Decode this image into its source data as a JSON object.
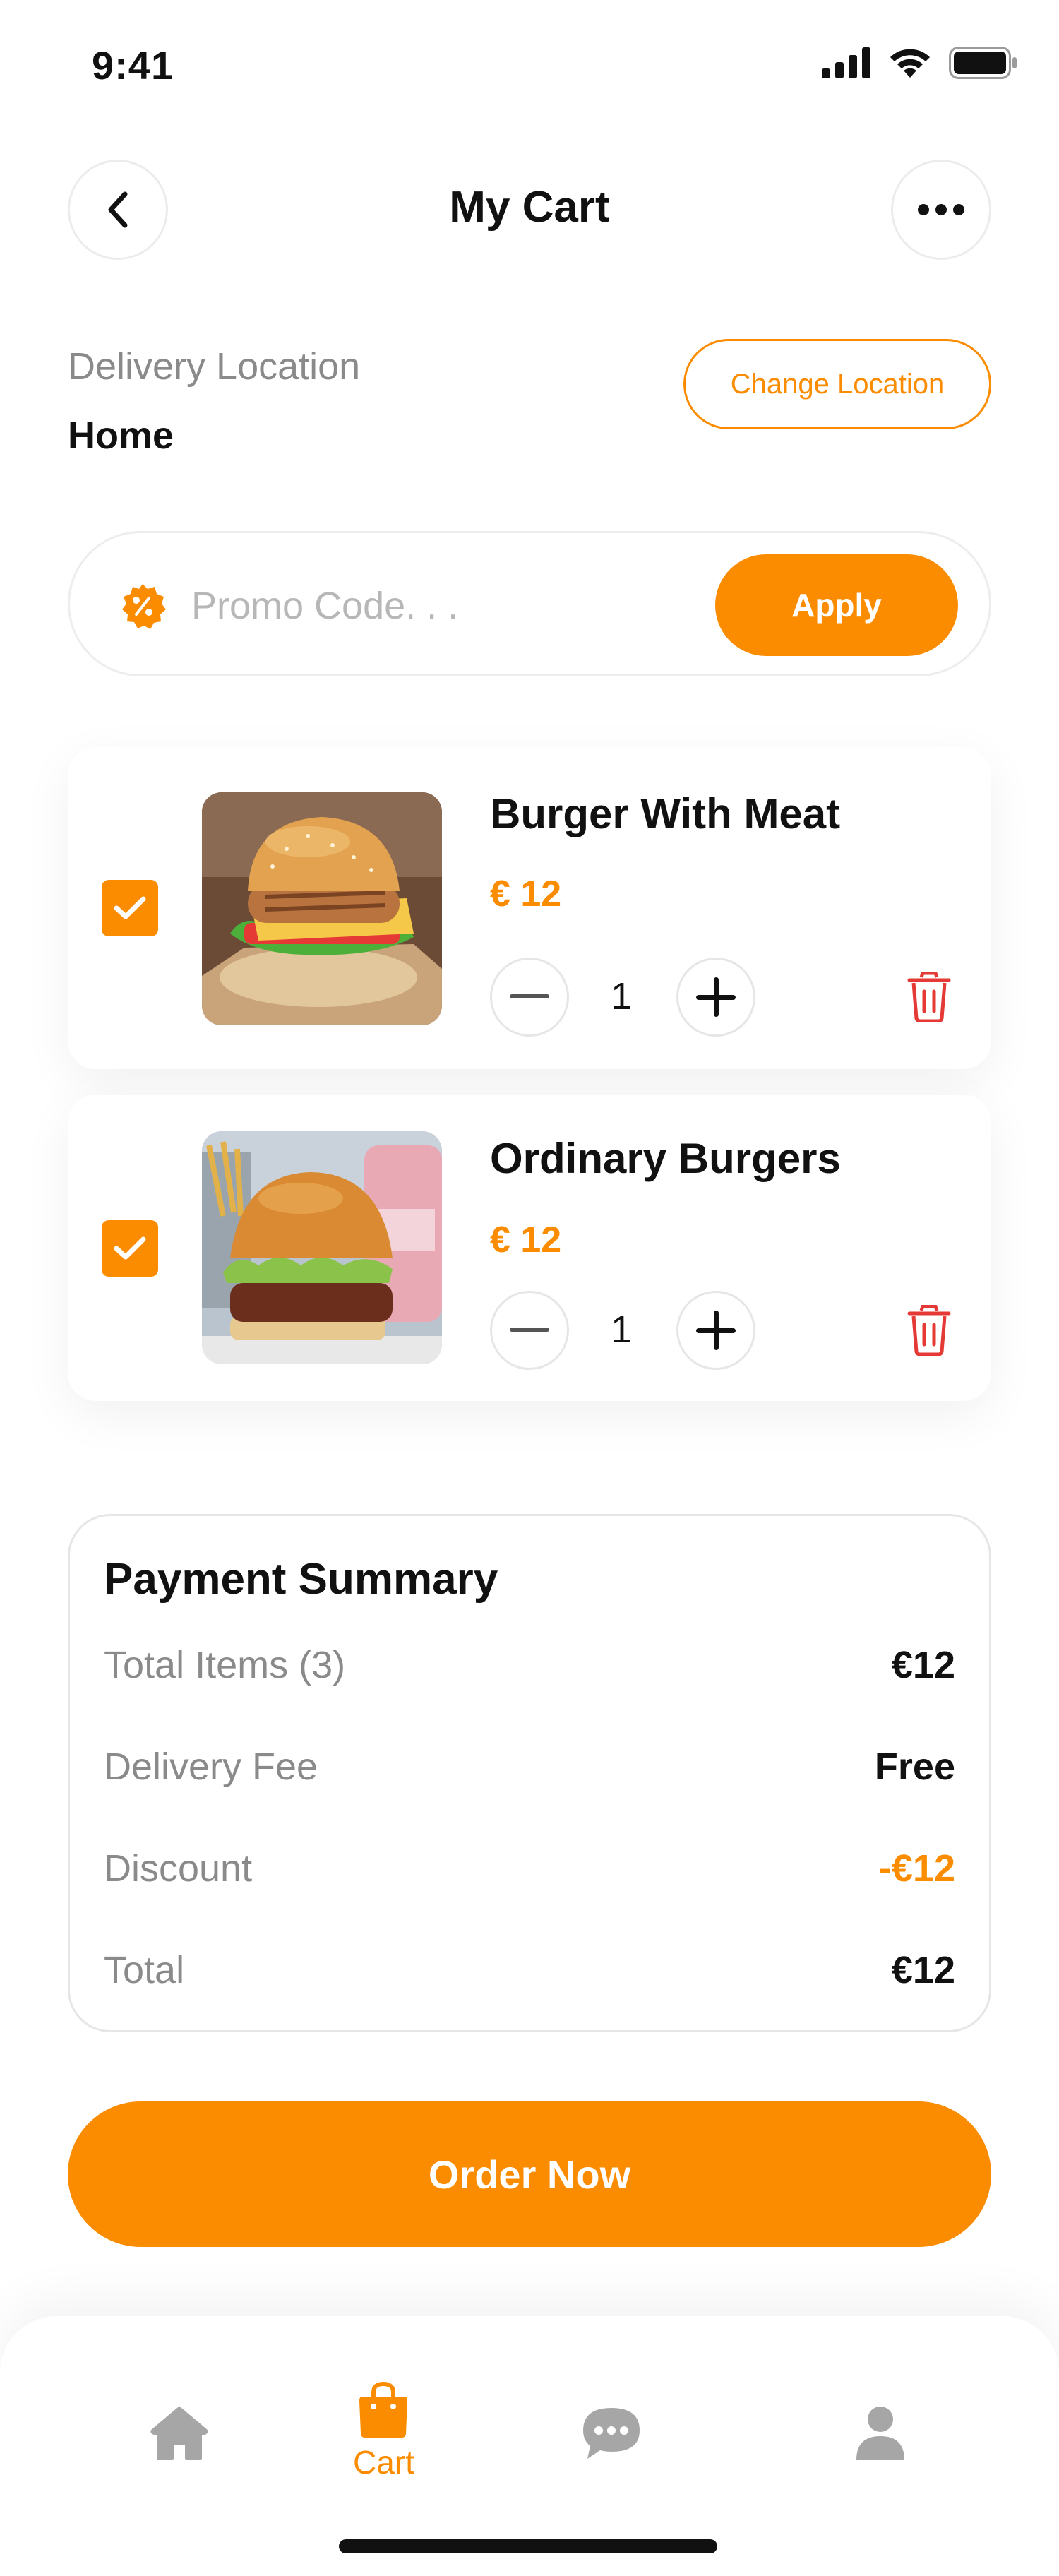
{
  "status_bar": {
    "time": "9:41"
  },
  "header": {
    "title": "My Cart"
  },
  "delivery": {
    "label": "Delivery Location",
    "value": "Home",
    "change_label": "Change Location"
  },
  "promo": {
    "placeholder": "Promo Code. . .",
    "apply_label": "Apply"
  },
  "cart": {
    "items": [
      {
        "name": "Burger With Meat",
        "price": "€ 12",
        "quantity": "1",
        "checked": true
      },
      {
        "name": "Ordinary Burgers",
        "price": "€ 12",
        "quantity": "1",
        "checked": true
      }
    ]
  },
  "summary": {
    "title": "Payment Summary",
    "rows": [
      {
        "label": "Total Items (3)",
        "value": "€12"
      },
      {
        "label": "Delivery Fee",
        "value": "Free"
      },
      {
        "label": "Discount",
        "value": "-€12"
      },
      {
        "label": "Total",
        "value": "€12"
      }
    ]
  },
  "order_button": {
    "label": "Order Now"
  },
  "nav": {
    "items": [
      {
        "icon": "home-icon",
        "label": ""
      },
      {
        "icon": "bag-icon",
        "label": "Cart",
        "active": true
      },
      {
        "icon": "chat-icon",
        "label": ""
      },
      {
        "icon": "user-icon",
        "label": ""
      }
    ]
  },
  "colors": {
    "accent": "#fb8c00",
    "danger": "#e53935",
    "muted": "#8a8a8a",
    "inactive_icon": "#a6a6a6"
  }
}
